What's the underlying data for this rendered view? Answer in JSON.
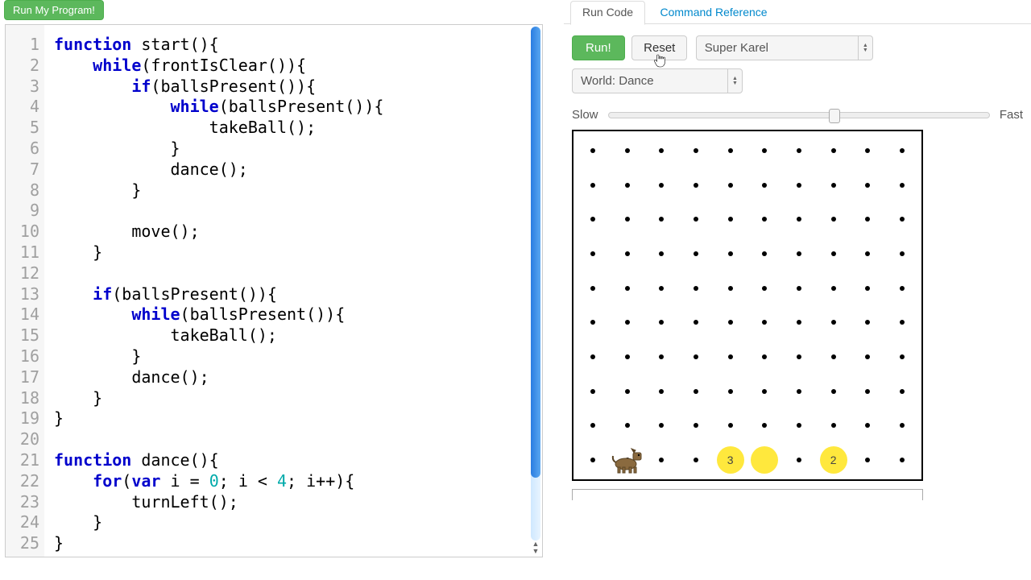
{
  "header": {
    "run_program_label": "Run My Program!"
  },
  "tabs": {
    "run_code": "Run Code",
    "command_ref": "Command Reference"
  },
  "controls": {
    "run_label": "Run!",
    "reset_label": "Reset",
    "karel_type": "Super Karel",
    "world_label": "World: Dance",
    "slow_label": "Slow",
    "fast_label": "Fast"
  },
  "world": {
    "cols": 10,
    "rows": 10,
    "karel": {
      "col": 1,
      "row": 0
    },
    "balls": [
      {
        "col": 4,
        "row": 0,
        "count": 3,
        "show_count": true
      },
      {
        "col": 5,
        "row": 0,
        "count": 1,
        "show_count": false
      },
      {
        "col": 7,
        "row": 0,
        "count": 2,
        "show_count": true
      }
    ]
  },
  "code": [
    {
      "n": 1,
      "indent": 0,
      "tokens": [
        [
          "kw",
          "function"
        ],
        [
          "",
          " start(){"
        ]
      ]
    },
    {
      "n": 2,
      "indent": 1,
      "tokens": [
        [
          "kw",
          "while"
        ],
        [
          "",
          "(frontIsClear()){"
        ]
      ]
    },
    {
      "n": 3,
      "indent": 2,
      "tokens": [
        [
          "kw",
          "if"
        ],
        [
          "",
          "(ballsPresent()){"
        ]
      ]
    },
    {
      "n": 4,
      "indent": 3,
      "tokens": [
        [
          "kw",
          "while"
        ],
        [
          "",
          "(ballsPresent()){"
        ]
      ]
    },
    {
      "n": 5,
      "indent": 4,
      "tokens": [
        [
          "",
          "takeBall();"
        ]
      ]
    },
    {
      "n": 6,
      "indent": 3,
      "tokens": [
        [
          "",
          "}"
        ]
      ]
    },
    {
      "n": 7,
      "indent": 3,
      "tokens": [
        [
          "",
          "dance();"
        ]
      ]
    },
    {
      "n": 8,
      "indent": 2,
      "tokens": [
        [
          "",
          "}"
        ]
      ]
    },
    {
      "n": 9,
      "indent": 2,
      "tokens": []
    },
    {
      "n": 10,
      "indent": 2,
      "tokens": [
        [
          "",
          "move();"
        ]
      ]
    },
    {
      "n": 11,
      "indent": 1,
      "tokens": [
        [
          "",
          "}"
        ]
      ]
    },
    {
      "n": 12,
      "indent": 1,
      "tokens": []
    },
    {
      "n": 13,
      "indent": 1,
      "tokens": [
        [
          "kw",
          "if"
        ],
        [
          "",
          "(ballsPresent()){"
        ]
      ]
    },
    {
      "n": 14,
      "indent": 2,
      "tokens": [
        [
          "kw",
          "while"
        ],
        [
          "",
          "(ballsPresent()){"
        ]
      ]
    },
    {
      "n": 15,
      "indent": 3,
      "tokens": [
        [
          "",
          "takeBall();"
        ]
      ]
    },
    {
      "n": 16,
      "indent": 2,
      "tokens": [
        [
          "",
          "}"
        ]
      ]
    },
    {
      "n": 17,
      "indent": 2,
      "tokens": [
        [
          "",
          "dance();"
        ]
      ]
    },
    {
      "n": 18,
      "indent": 1,
      "tokens": [
        [
          "",
          "}"
        ]
      ]
    },
    {
      "n": 19,
      "indent": 0,
      "tokens": [
        [
          "",
          "}"
        ]
      ]
    },
    {
      "n": 20,
      "indent": 0,
      "tokens": []
    },
    {
      "n": 21,
      "indent": 0,
      "tokens": [
        [
          "kw",
          "function"
        ],
        [
          "",
          " dance(){"
        ]
      ]
    },
    {
      "n": 22,
      "indent": 1,
      "tokens": [
        [
          "kw",
          "for"
        ],
        [
          "",
          "("
        ],
        [
          "kw",
          "var"
        ],
        [
          "",
          " i = "
        ],
        [
          "num",
          "0"
        ],
        [
          "",
          "; i < "
        ],
        [
          "num",
          "4"
        ],
        [
          "",
          "; i++){"
        ]
      ]
    },
    {
      "n": 23,
      "indent": 2,
      "tokens": [
        [
          "",
          "turnLeft();"
        ]
      ]
    },
    {
      "n": 24,
      "indent": 1,
      "tokens": [
        [
          "",
          "}"
        ]
      ]
    },
    {
      "n": 25,
      "indent": 0,
      "tokens": [
        [
          "",
          "}"
        ]
      ]
    }
  ]
}
